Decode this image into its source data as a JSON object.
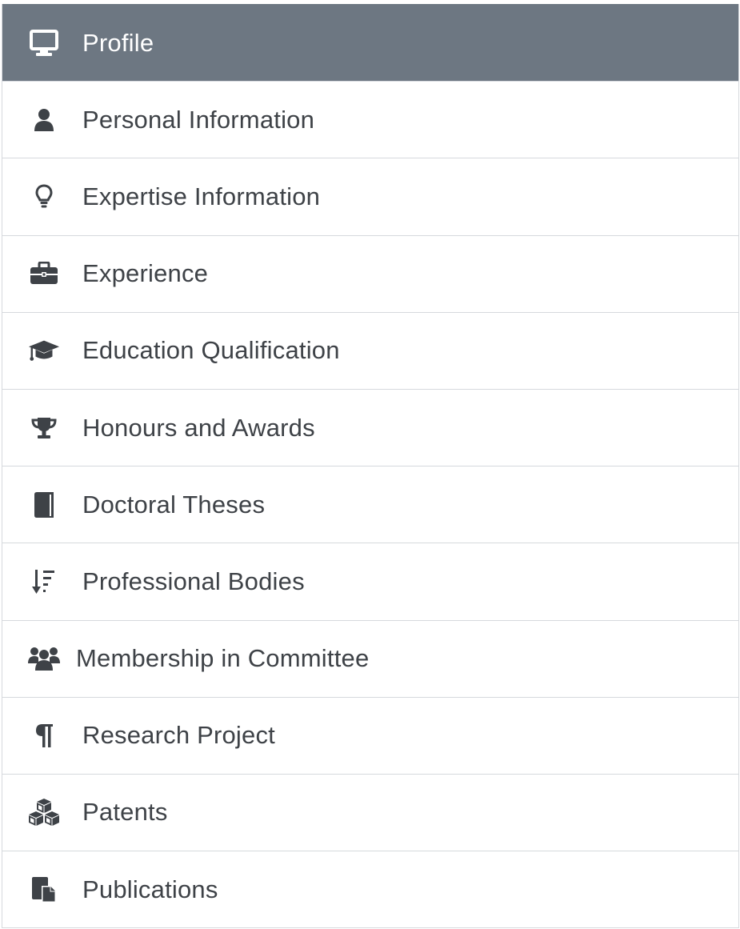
{
  "menu": {
    "items": [
      {
        "label": "Profile",
        "icon": "desktop-icon",
        "active": true
      },
      {
        "label": "Personal Information",
        "icon": "user-icon"
      },
      {
        "label": "Expertise Information",
        "icon": "lightbulb-icon"
      },
      {
        "label": "Experience",
        "icon": "briefcase-icon"
      },
      {
        "label": "Education Qualification",
        "icon": "graduation-cap-icon"
      },
      {
        "label": "Honours and Awards",
        "icon": "trophy-icon"
      },
      {
        "label": "Doctoral Theses",
        "icon": "book-icon"
      },
      {
        "label": "Professional Bodies",
        "icon": "sort-amount-down-icon"
      },
      {
        "label": "Membership in Committee",
        "icon": "users-icon"
      },
      {
        "label": "Research Project",
        "icon": "paragraph-icon"
      },
      {
        "label": "Patents",
        "icon": "cubes-icon"
      },
      {
        "label": "Publications",
        "icon": "paste-icon"
      }
    ]
  },
  "colors": {
    "active_bg": "#6d7782",
    "text": "#3e4247",
    "border": "#d6d9dd"
  }
}
